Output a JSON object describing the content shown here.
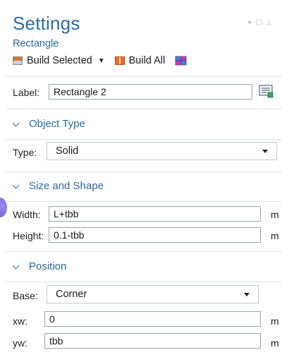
{
  "header": {
    "title": "Settings",
    "subtitle": "Rectangle"
  },
  "toolbar": {
    "build_selected_label": "Build Selected",
    "build_all_label": "Build All"
  },
  "label_row": {
    "label": "Label:",
    "value": "Rectangle 2"
  },
  "object_type": {
    "heading": "Object Type",
    "type_label": "Type:",
    "type_value": "Solid"
  },
  "size_shape": {
    "heading": "Size and Shape",
    "width_label": "Width:",
    "width_value": "L+tbb",
    "width_unit": "m",
    "height_label": "Height:",
    "height_value": "0.1-tbb",
    "height_unit": "m"
  },
  "position": {
    "heading": "Position",
    "base_label": "Base:",
    "base_value": "Corner",
    "xw_label": "xw:",
    "xw_value": "0",
    "xw_unit": "m",
    "yw_label": "yw:",
    "yw_value": "tbb",
    "yw_unit": "m"
  },
  "colors": {
    "accent": "#2d6aa0",
    "divider": "#dcdfe3"
  },
  "icons": [
    "chevron-down-icon",
    "build-selected-icon",
    "build-all-icon",
    "geometry-icon",
    "label-edit-icon",
    "minimize-icon",
    "maximize-icon",
    "pin-icon"
  ]
}
